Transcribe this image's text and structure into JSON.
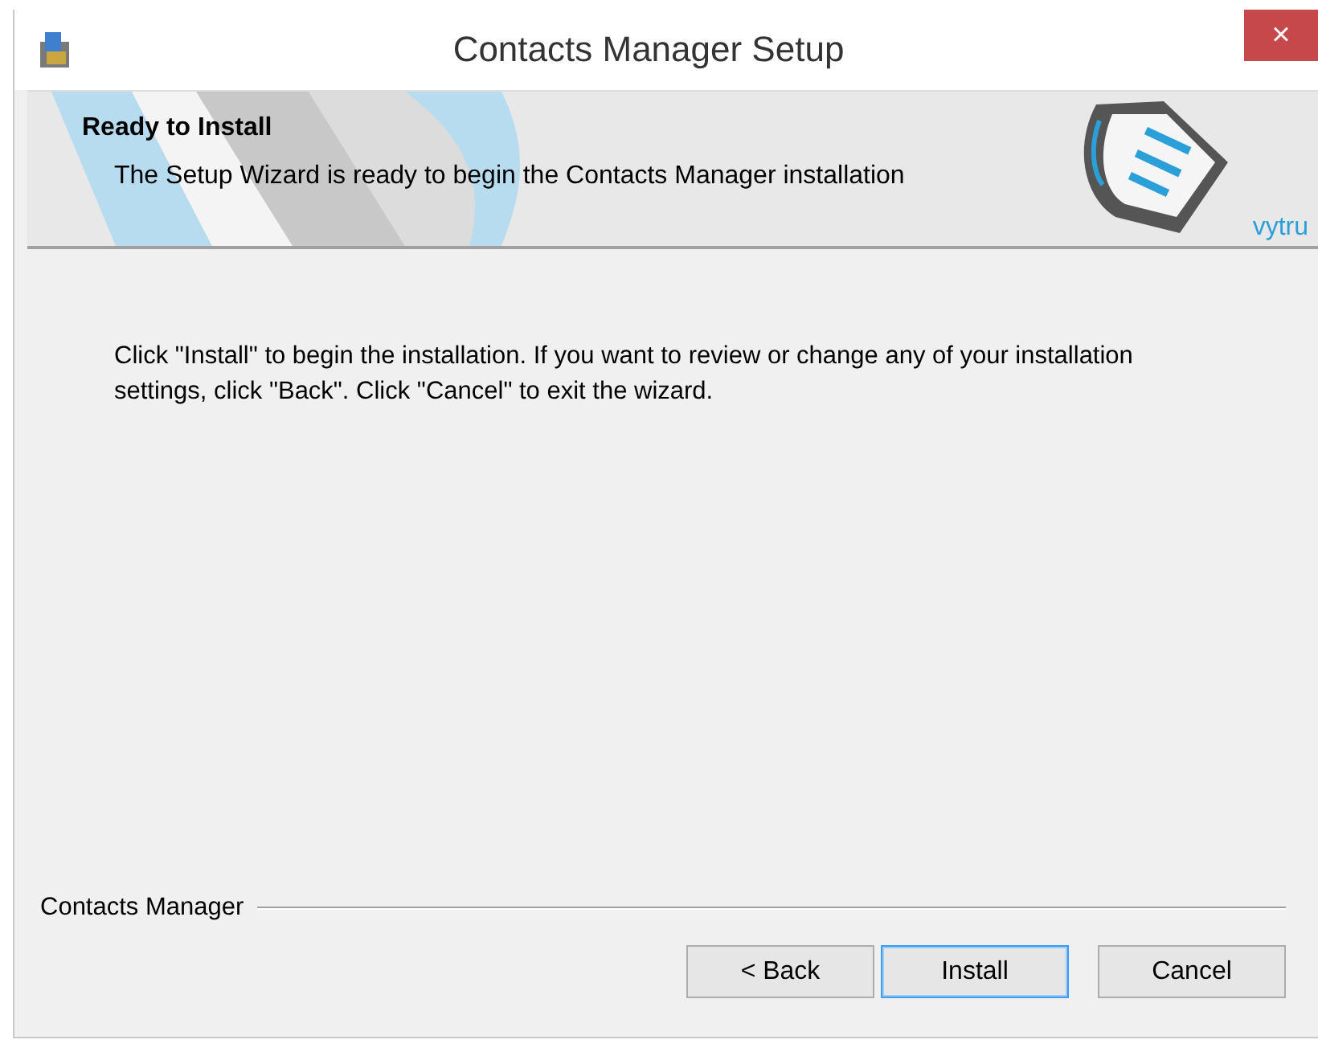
{
  "window": {
    "title": "Contacts Manager Setup",
    "close": "×"
  },
  "banner": {
    "title": "Ready to Install",
    "subtitle": "The Setup Wizard is ready to begin the Contacts Manager installation",
    "logo_text": "vytru"
  },
  "body": {
    "text": "Click \"Install\" to begin the installation.  If you want to review or change any of your installation settings, click \"Back\".  Click \"Cancel\" to exit the wizard."
  },
  "footer": {
    "group_label": "Contacts Manager"
  },
  "buttons": [
    {
      "label": "< Back",
      "default": false
    },
    {
      "label": "Install",
      "default": true
    },
    {
      "label": "Cancel",
      "default": false
    }
  ]
}
